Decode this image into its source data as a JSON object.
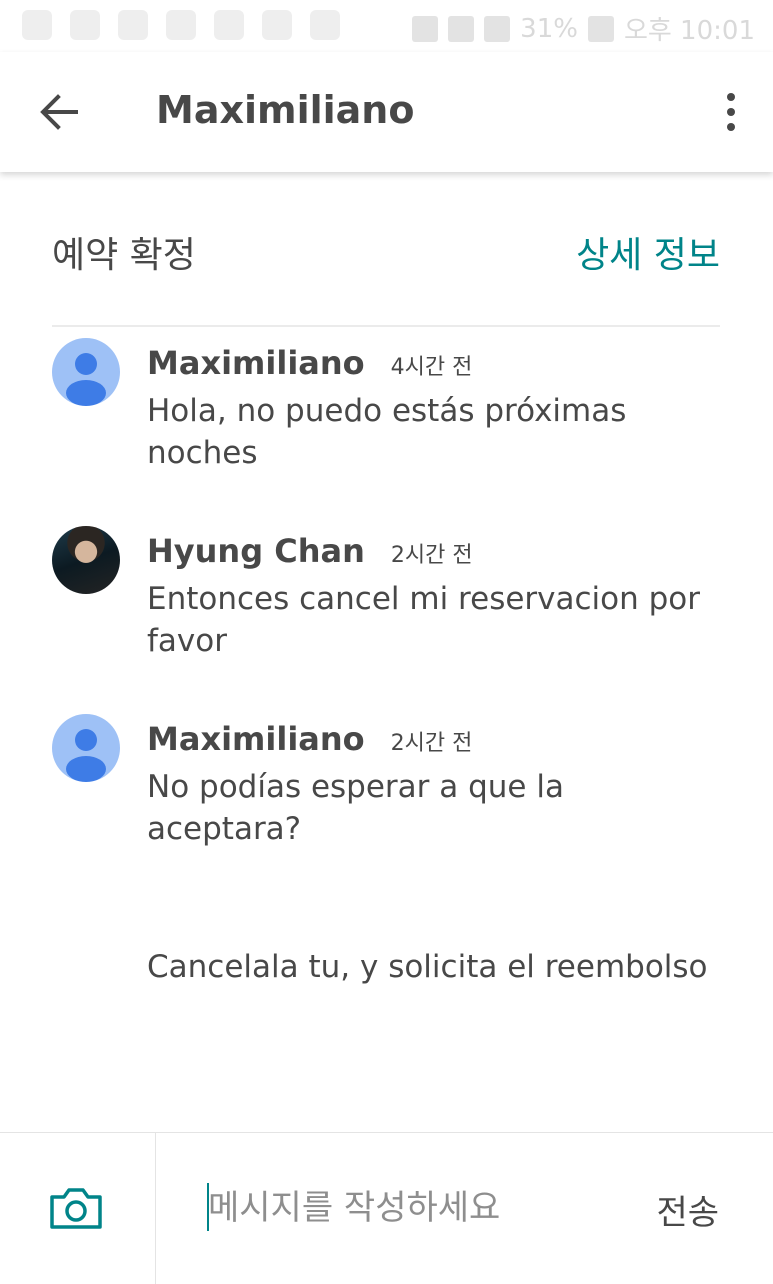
{
  "status_bar": {
    "battery": "31%",
    "time": "오후 10:01",
    "left_icons": [
      "airbnb-icon",
      "facebook-icon",
      "star-icon",
      "download-icon",
      "chat-icon",
      "instagram-icon",
      "play-store-icon"
    ],
    "right_icons": [
      "vibrate-icon",
      "wifi-icon",
      "signal-icon",
      "battery-icon"
    ]
  },
  "header": {
    "title": "Maximiliano",
    "back_icon": "arrow-left-icon",
    "menu_icon": "more-vertical-icon"
  },
  "reservation": {
    "status": "예약 확정",
    "details_link": "상세 정보"
  },
  "messages": [
    {
      "sender": "Maximiliano",
      "time": "4시간 전",
      "avatar": "default-avatar",
      "text": "Hola, no puedo estás próximas noches"
    },
    {
      "sender": "Hyung Chan",
      "time": "2시간 전",
      "avatar": "user-photo",
      "text": "Entonces cancel mi reservacion por favor"
    },
    {
      "sender": "Maximiliano",
      "time": "2시간 전",
      "avatar": "default-avatar",
      "text": "No podías esperar a que la aceptara?"
    },
    {
      "text": "Cancelala tu, y solicita el reembolso"
    }
  ],
  "composer": {
    "camera_icon": "camera-icon",
    "placeholder": "메시지를 작성하세요",
    "value": "",
    "send_label": "전송"
  },
  "colors": {
    "accent": "#008489",
    "text": "#484848",
    "avatar_bg": "#9ec1f6",
    "avatar_fg": "#3e7ce6"
  }
}
